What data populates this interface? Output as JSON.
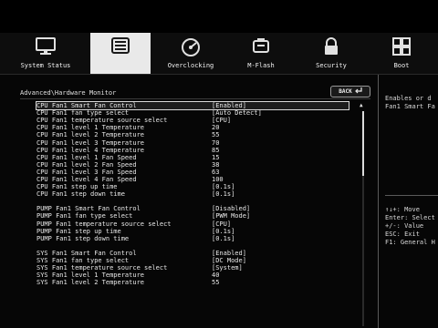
{
  "menu": [
    {
      "label": "System Status",
      "icon": "monitor-icon"
    },
    {
      "label": "",
      "icon": "settings-list-icon"
    },
    {
      "label": "Overclocking",
      "icon": "speedometer-icon"
    },
    {
      "label": "M-Flash",
      "icon": "flash-drive-icon"
    },
    {
      "label": "Security",
      "icon": "lock-icon"
    },
    {
      "label": "Boot",
      "icon": "boot-icon"
    }
  ],
  "breadcrumb": "Advanced\\Hardware Monitor",
  "back_label": "BACK",
  "rows": [
    {
      "label": "CPU Fan1 Smart Fan Control",
      "value": "[Enabled]"
    },
    {
      "label": "CPU Fan1 fan type select",
      "value": "[Auto Detect]"
    },
    {
      "label": "CPU Fan1 temperature source select",
      "value": "[CPU]"
    },
    {
      "label": "CPU Fan1 level 1 Temperature",
      "value": "20"
    },
    {
      "label": "CPU Fan1 level 2 Temperature",
      "value": "55"
    },
    {
      "label": "CPU Fan1 level 3 Temperature",
      "value": "70"
    },
    {
      "label": "CPU Fan1 level 4 Temperature",
      "value": "85"
    },
    {
      "label": "CPU Fan1 level 1 Fan Speed",
      "value": "15"
    },
    {
      "label": "CPU Fan1 level 2 Fan Speed",
      "value": "38"
    },
    {
      "label": "CPU Fan1 level 3 Fan Speed",
      "value": "63"
    },
    {
      "label": "CPU Fan1 level 4 Fan Speed",
      "value": "100"
    },
    {
      "label": "CPU Fan1 step up time",
      "value": "[0.1s]"
    },
    {
      "label": "CPU Fan1 step down time",
      "value": "[0.1s]"
    },
    {
      "label": "PUMP Fan1 Smart Fan Control",
      "value": "[Disabled]"
    },
    {
      "label": "PUMP Fan1 fan type select",
      "value": "[PWM Mode]"
    },
    {
      "label": "PUMP Fan1 temperature source select",
      "value": "[CPU]"
    },
    {
      "label": "PUMP Fan1 step up time",
      "value": "[0.1s]"
    },
    {
      "label": "PUMP Fan1 step down time",
      "value": "[0.1s]"
    },
    {
      "label": "SYS Fan1 Smart Fan Control",
      "value": "[Enabled]"
    },
    {
      "label": "SYS Fan1 fan type select",
      "value": "[DC Mode]"
    },
    {
      "label": "SYS Fan1 temperature source select",
      "value": "[System]"
    },
    {
      "label": "SYS Fan1 level 1 Temperature",
      "value": "40"
    },
    {
      "label": "SYS Fan1 level 2 Temperature",
      "value": "55"
    }
  ],
  "help": {
    "line1": "Enables or d",
    "line2": "Fan1 Smart Fa"
  },
  "keys": [
    "↑↓+: Move",
    "Enter: Select",
    "+/-: Value",
    "ESC: Exit",
    "F1: General H"
  ],
  "scroll_position_fraction": 0.0,
  "scroll_visible_fraction": 0.3
}
